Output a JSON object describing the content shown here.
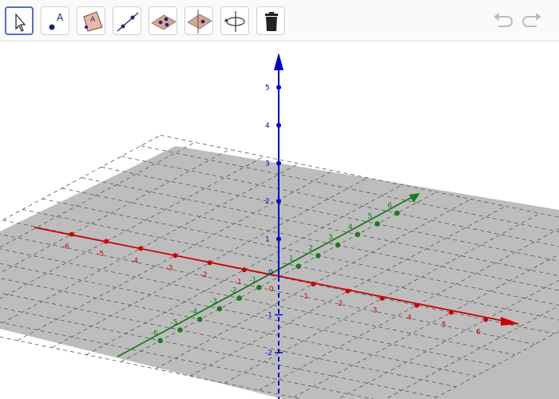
{
  "toolbar": {
    "tools": [
      {
        "name": "move-tool-button",
        "icon": "arrow-cursor-icon",
        "selected": true
      },
      {
        "name": "point-tool-button",
        "icon": "point-icon",
        "label": "A"
      },
      {
        "name": "polygon-tool-button",
        "icon": "polygon-icon",
        "label": "A"
      },
      {
        "name": "line-tool-button",
        "icon": "line-through-points-icon"
      },
      {
        "name": "plane-tool-button",
        "icon": "plane-three-points-icon"
      },
      {
        "name": "perpendicular-plane-tool-button",
        "icon": "perpendicular-plane-icon"
      },
      {
        "name": "rotate-view-tool-button",
        "icon": "rotate-view-icon"
      },
      {
        "name": "delete-tool-button",
        "icon": "trash-icon"
      }
    ],
    "undo_icon": "undo-icon",
    "redo_icon": "redo-icon"
  },
  "view": {
    "origin_label": "0",
    "x_axis": {
      "color": "#cc0000",
      "labels": [
        "-6",
        "-5",
        "-4",
        "-3",
        "-2",
        "-1",
        "0",
        "1",
        "2",
        "3",
        "4",
        "5",
        "6"
      ]
    },
    "y_axis": {
      "color": "#1a7a1a",
      "labels": [
        "-6",
        "-5",
        "-4",
        "-3",
        "-2",
        "-1",
        "1",
        "2",
        "3",
        "4",
        "5",
        "6"
      ]
    },
    "z_axis": {
      "color": "#0000cc",
      "labels": [
        "-2",
        "-1",
        "1",
        "2",
        "3",
        "4",
        "5"
      ]
    },
    "plane_color": "#bdbdbd"
  }
}
